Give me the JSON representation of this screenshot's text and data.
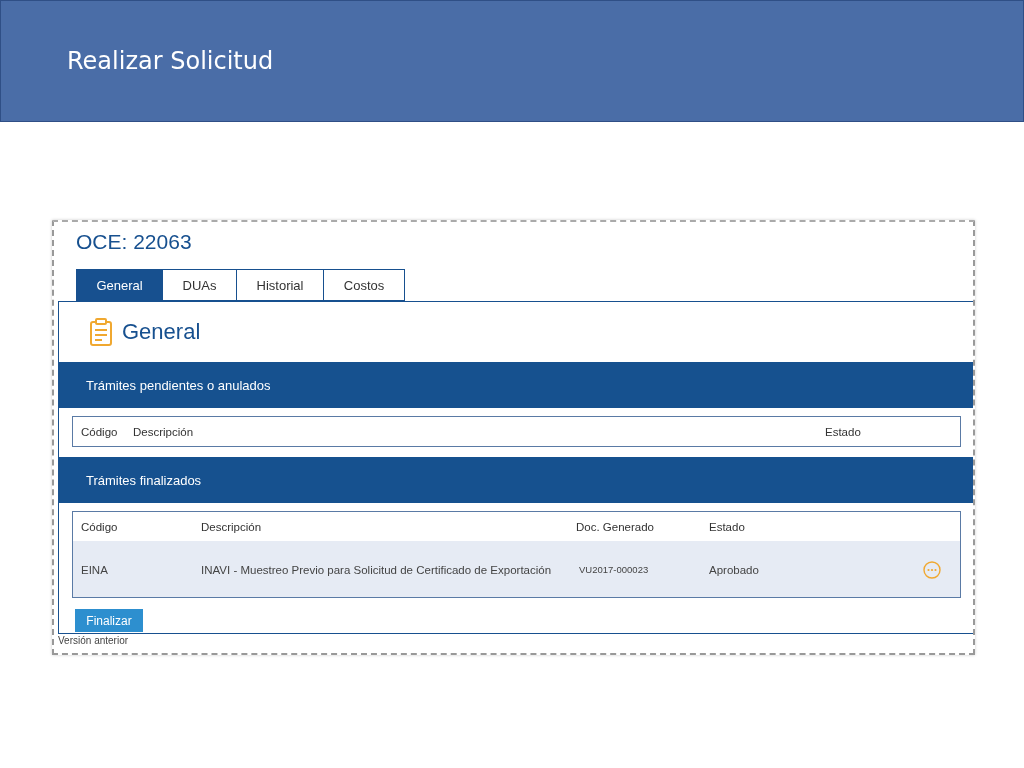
{
  "slide": {
    "title": "Realizar Solicitud"
  },
  "page": {
    "title": "OCE: 22063"
  },
  "tabs": [
    {
      "label": "General",
      "selected": true
    },
    {
      "label": "DUAs",
      "selected": false
    },
    {
      "label": "Historial",
      "selected": false
    },
    {
      "label": "Costos",
      "selected": false
    }
  ],
  "section": {
    "title": "General"
  },
  "pending": {
    "title": "Trámites pendientes o anulados",
    "columns": [
      "Código",
      "Descripción",
      "Estado"
    ]
  },
  "finished": {
    "title": "Trámites finalizados",
    "columns": [
      "Código",
      "Descripción",
      "Doc. Generado",
      "Estado"
    ],
    "rows": [
      {
        "cells": [
          "EINA",
          "INAVI - Muestreo Previo para Solicitud de Certificado de Exportación",
          "VU2017-000023",
          "Aprobado"
        ]
      }
    ]
  },
  "finalize_button": "Finalizar",
  "footer_link": "Versión anterior"
}
